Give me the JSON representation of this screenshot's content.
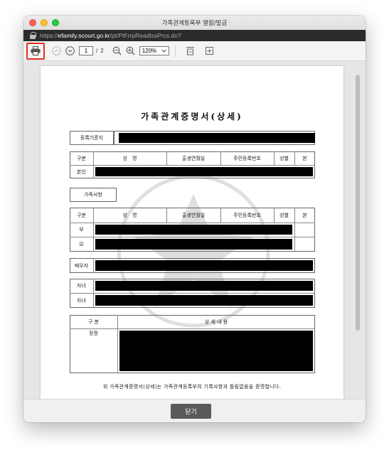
{
  "window": {
    "title": "가족관계등록부 열람/발급"
  },
  "urlbar": {
    "scheme": "https://",
    "host": "efamily.scourt.go.kr",
    "path": "/pt/PtFrrpReadIssPrcs.do?"
  },
  "toolbar": {
    "current_page": "1",
    "page_separator": "/",
    "total_pages": "2",
    "zoom_level": "120%"
  },
  "document": {
    "title": "가족관계증명서(상세)",
    "reference_label": "등록기준지",
    "main_table": {
      "headers": [
        "구분",
        "성　명",
        "출생연월일",
        "주민등록번호",
        "성별",
        "본"
      ],
      "row_label": "본인"
    },
    "family_section_label": "가족사항",
    "family_table": {
      "headers": [
        "구분",
        "성　명",
        "출생연월일",
        "주민등록번호",
        "성별",
        "본"
      ],
      "rows": [
        "부",
        "모"
      ]
    },
    "spouse_label": "배우자",
    "children_labels": [
      "자녀",
      "자녀"
    ],
    "detail_table": {
      "headers": [
        "구 분",
        "상 세 내 용"
      ],
      "row_label": "정정"
    },
    "certification_text": "위 가족관계증명서(상세)는 가족관계등록부의 기록사항과 틀림없음을 증명합니다."
  },
  "footer": {
    "close_label": "닫기"
  },
  "colors": {
    "highlight": "#e0301e",
    "close_button": "#5a5a5a",
    "redaction": "#000000"
  }
}
